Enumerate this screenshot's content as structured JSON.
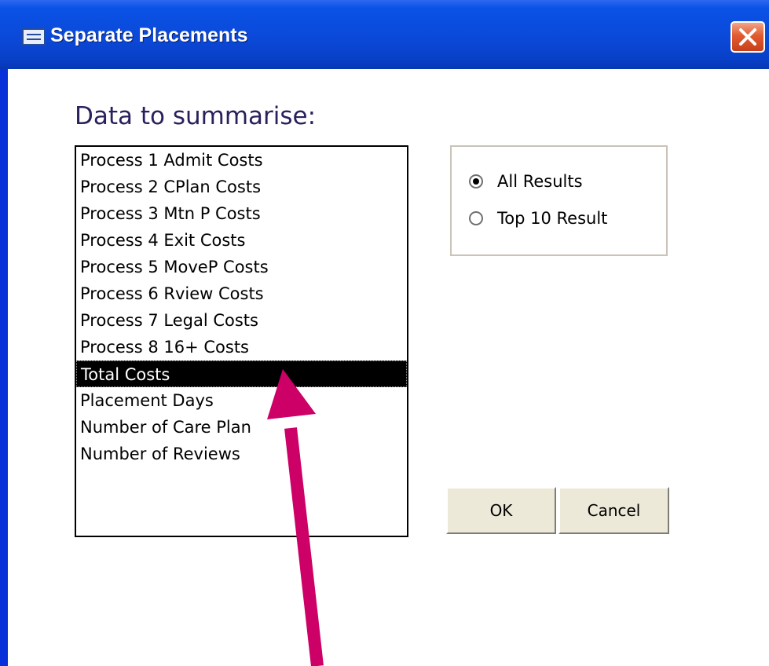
{
  "window": {
    "title": "Separate Placements"
  },
  "form": {
    "heading": "Data to summarise:",
    "list_items": [
      "Process 1 Admit Costs",
      "Process 2 CPlan Costs",
      "Process 3 Mtn P Costs",
      "Process 4 Exit Costs",
      "Process 5 MoveP Costs",
      "Process 6 Rview Costs",
      "Process 7 Legal Costs",
      "Process 8 16+ Costs",
      "Total Costs",
      "Placement Days",
      "Number of Care Plan",
      "Number of Reviews"
    ],
    "selected_item": "Total Costs",
    "options": {
      "all_results": "All Results",
      "top10": "Top 10 Result",
      "selected": "All Results"
    },
    "buttons": {
      "ok": "OK",
      "cancel": "Cancel"
    }
  },
  "annotation": {
    "arrow_color": "#cc0066",
    "points_to": "Total Costs"
  },
  "colors": {
    "titlebar": "#0b49d8",
    "close_button": "#e25b2f",
    "heading_text": "#2b1f5c",
    "button_face": "#ece9d8"
  }
}
